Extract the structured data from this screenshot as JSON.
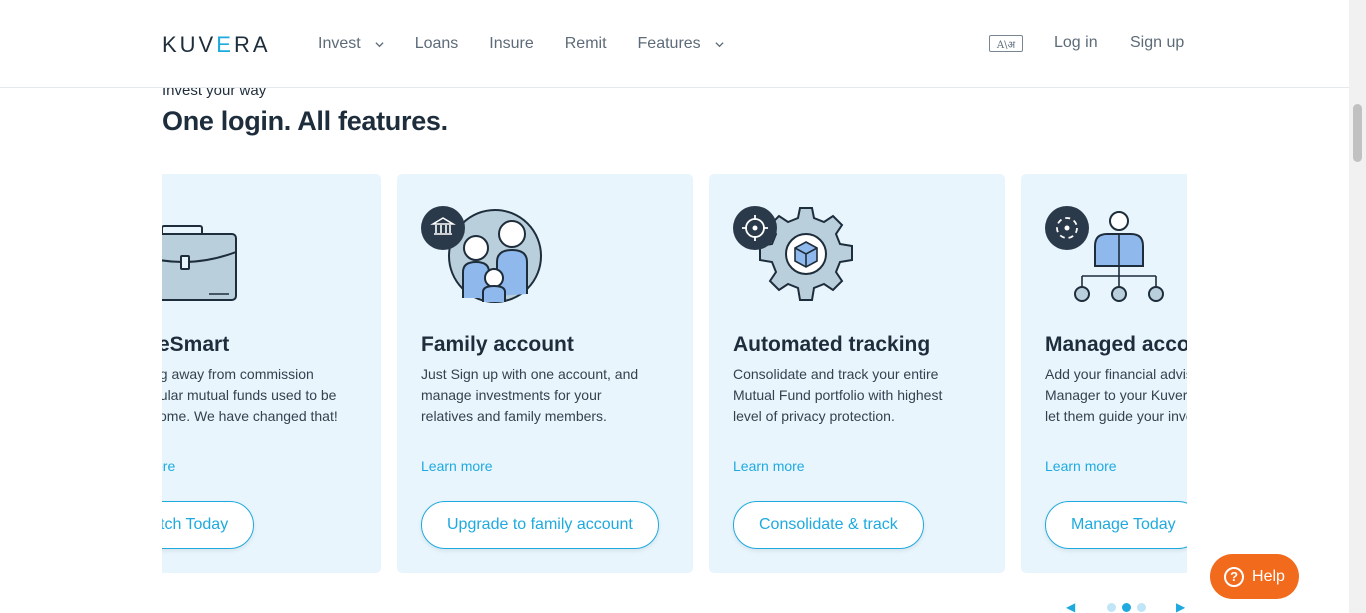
{
  "header": {
    "logo_left": "KUV",
    "logo_accent": "E",
    "logo_right": "RA",
    "nav": [
      {
        "label": "Invest",
        "has_dropdown": true
      },
      {
        "label": "Loans",
        "has_dropdown": false
      },
      {
        "label": "Insure",
        "has_dropdown": false
      },
      {
        "label": "Remit",
        "has_dropdown": false
      },
      {
        "label": "Features",
        "has_dropdown": true
      }
    ],
    "language_toggle": "A\\अ",
    "login": "Log in",
    "signup": "Sign up"
  },
  "section": {
    "kicker": "Invest your way",
    "headline": "One login. All features."
  },
  "cards": [
    {
      "title": "eSmart",
      "description": "ng away from commission\ngular mutual funds used to be\nsome. We have changed that!",
      "learn_more": "ore",
      "cta": "tch Today",
      "icon": "briefcase-icon"
    },
    {
      "title": "Family account",
      "description": "Just Sign up with one account, and\nmanage investments for your\nrelatives and family members.",
      "learn_more": "Learn more",
      "cta": "Upgrade to family account",
      "icon": "family-icon"
    },
    {
      "title": "Automated tracking",
      "description": "Consolidate and track your entire\nMutual Fund portfolio with highest\nlevel of privacy protection.",
      "learn_more": "Learn more",
      "cta": "Consolidate & track",
      "icon": "gear-icon"
    },
    {
      "title": "Managed accounts",
      "description": "Add your financial advisor or Wealth\nManager to your Kuvera account and\nlet them guide your investments.",
      "learn_more": "Learn more",
      "cta": "Manage Today",
      "icon": "manager-icon"
    }
  ],
  "pager": {
    "prev": "◀",
    "next": "▶",
    "dots": 3,
    "active_dot": 2
  },
  "help": {
    "label": "Help",
    "icon": "question-icon"
  },
  "colors": {
    "accent": "#1eaadf",
    "card_bg": "#e9f5fd",
    "help": "#f26a1b",
    "dark": "#1e2d3b"
  }
}
